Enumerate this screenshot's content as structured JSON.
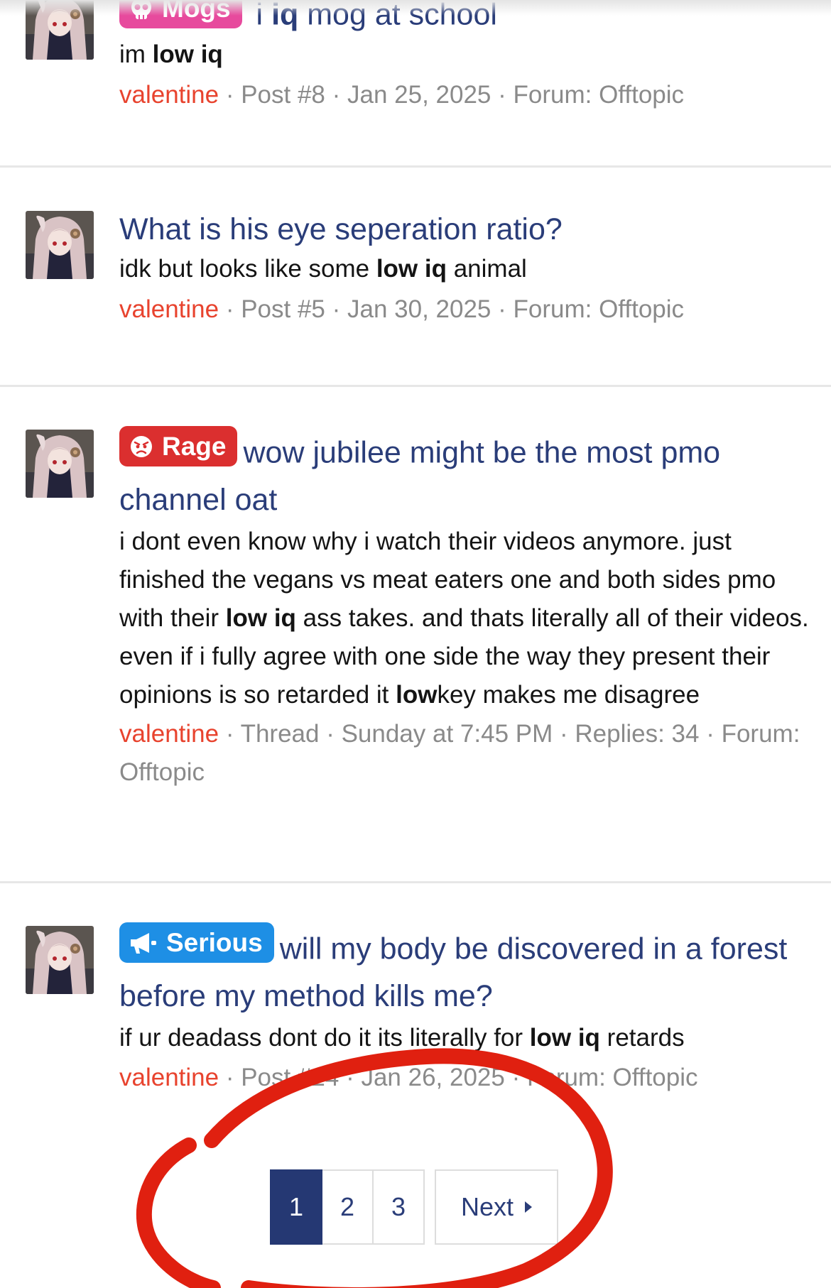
{
  "results": [
    {
      "prefix": {
        "label": "Mogs",
        "icon": "skull-icon",
        "color": "#e74a9d"
      },
      "title_parts": [
        {
          "text": " i ",
          "b": false
        },
        {
          "text": "iq",
          "b": true
        },
        {
          "text": " mog at school",
          "b": false
        }
      ],
      "snippet_parts": [
        {
          "text": "im ",
          "b": false
        },
        {
          "text": "low iq",
          "b": true
        }
      ],
      "user": "valentine",
      "meta": " · Post #8 · Jan 25, 2025 · Forum: Offtopic"
    },
    {
      "prefix": null,
      "title_parts": [
        {
          "text": "What is his eye seperation ratio?",
          "b": false
        }
      ],
      "snippet_parts": [
        {
          "text": "idk but looks like some ",
          "b": false
        },
        {
          "text": "low iq",
          "b": true
        },
        {
          "text": " animal",
          "b": false
        }
      ],
      "user": "valentine",
      "meta": " · Post #5 · Jan 30, 2025 · Forum: Offtopic"
    },
    {
      "prefix": {
        "label": "Rage",
        "icon": "angry-face-icon",
        "color": "#db2f2f"
      },
      "title_parts": [
        {
          "text": "wow jubilee might be the most pmo channel oat",
          "b": false
        }
      ],
      "snippet_parts": [
        {
          "text": "i dont even know why i watch their videos anymore. just finished the vegans vs meat eaters one and both sides pmo with their ",
          "b": false
        },
        {
          "text": "low iq",
          "b": true
        },
        {
          "text": " ass takes. and thats literally all of their videos. even if i fully agree with one side the way they present their opinions is so retarded it ",
          "b": false
        },
        {
          "text": "low",
          "b": true
        },
        {
          "text": "key makes me disagree",
          "b": false
        }
      ],
      "user": "valentine",
      "meta": " · Thread · Sunday at 7:45 PM · Replies: 34 · Forum: Offtopic"
    },
    {
      "prefix": {
        "label": "Serious",
        "icon": "megaphone-icon",
        "color": "#1e8fe5"
      },
      "title_parts": [
        {
          "text": "will my body be discovered in a forest before my method kills me?",
          "b": false
        }
      ],
      "snippet_parts": [
        {
          "text": "if ur deadass dont do it its literally for ",
          "b": false
        },
        {
          "text": "low iq",
          "b": true
        },
        {
          "text": " retards",
          "b": false
        }
      ],
      "user": "valentine",
      "meta": " · Post #24 · Jan 26, 2025 · Forum: Offtopic"
    }
  ],
  "pagination": {
    "pages": [
      "1",
      "2",
      "3"
    ],
    "current": "1",
    "next_label": "Next"
  },
  "annotation_color": "#e02010"
}
